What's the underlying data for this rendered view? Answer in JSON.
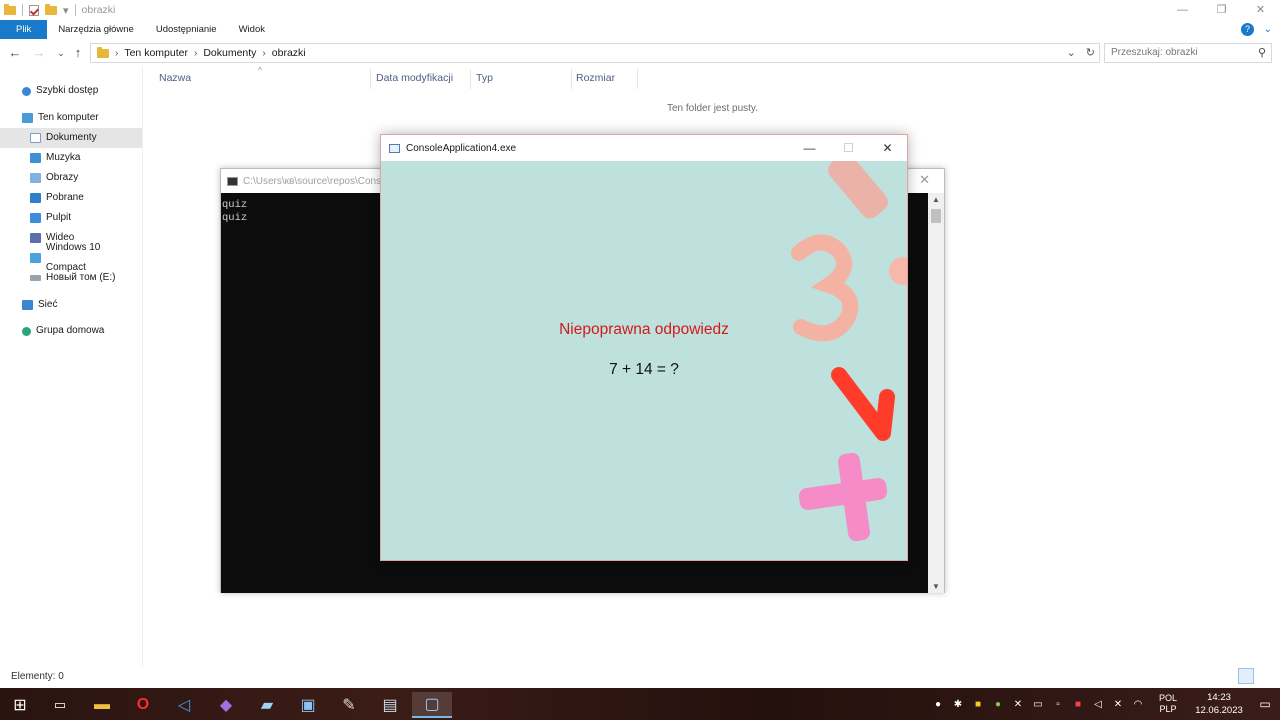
{
  "explorer": {
    "title": "obrazki",
    "ribbon_tabs": [
      "Plik",
      "Narzędzia główne",
      "Udostępnianie",
      "Widok"
    ],
    "breadcrumb": [
      "Ten komputer",
      "Dokumenty",
      "obrazki"
    ],
    "search_placeholder": "Przeszukaj: obrazki",
    "nav": {
      "quick_access": "Szybki dostęp",
      "this_pc": "Ten komputer",
      "documents": "Dokumenty",
      "music": "Muzyka",
      "pictures": "Obrazy",
      "downloads": "Pobrane",
      "desktop": "Pulpit",
      "videos": "Wideo",
      "win10": "Windows 10 Compact",
      "volume": "Новый том (E:)",
      "network": "Sieć",
      "homegroup": "Grupa domowa"
    },
    "columns": [
      "Nazwa",
      "Data modyfikacji",
      "Typ",
      "Rozmiar"
    ],
    "empty_message": "Ten folder jest pusty.",
    "status": "Elementy: 0"
  },
  "console": {
    "title": "C:\\Users\\кв\\source\\repos\\Conso",
    "lines": [
      "quiz",
      "quiz"
    ]
  },
  "quiz_window": {
    "title": "ConsoleApplication4.exe",
    "feedback": "Niepoprawna odpowiedz",
    "question": "7 + 14 = ?"
  },
  "taskbar": {
    "lang_top": "POL",
    "lang_bottom": "PLP",
    "time": "14:23",
    "date": "12.06.2023"
  },
  "colors": {
    "accent": "#1979ca",
    "error_text": "#d11a1a",
    "quiz_bg": "#bfe1dd"
  }
}
